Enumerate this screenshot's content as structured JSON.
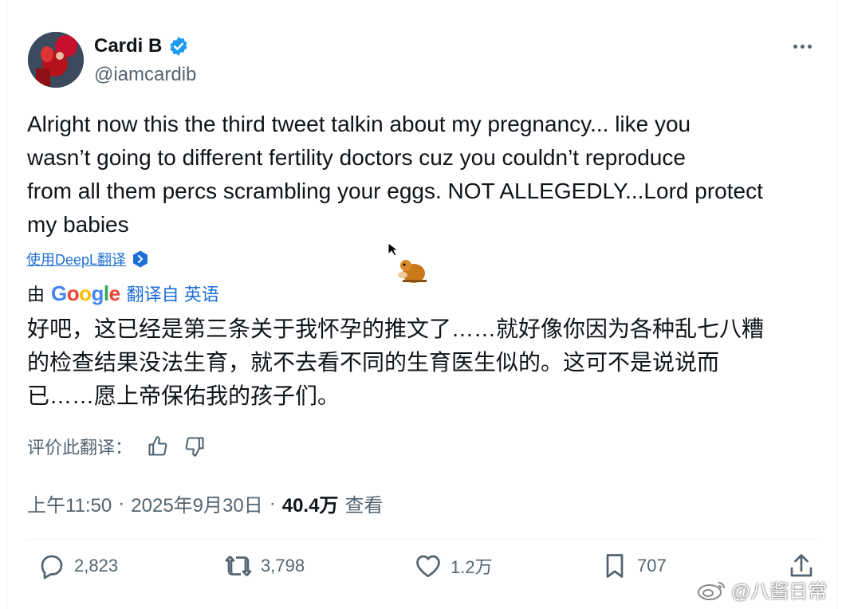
{
  "author": {
    "name": "Cardi B",
    "handle": "@iamcardib",
    "verified_color": "#1d9bf0"
  },
  "tweet": {
    "text": "Alright now this the third tweet talkin about my pregnancy... like you\nwasn’t going to different fertility doctors cuz you couldn’t reproduce\nfrom all them percs scrambling your eggs. NOT ALLEGEDLY...Lord protect\nmy babies"
  },
  "translation": {
    "deepl_link": "使用DeepL翻译",
    "by_label": "由",
    "google_letters": [
      "G",
      "o",
      "o",
      "g",
      "l",
      "e"
    ],
    "translate_from": "翻译自 英语",
    "text": "好吧，这已经是第三条关于我怀孕的推文了……就好像你因为各种乱七八糟\n的检查结果没法生育，就不去看不同的生育医生似的。这可不是说说而\n已……愿上帝保佑我的孩子们。",
    "rate_label": "评价此翻译："
  },
  "meta": {
    "time": "上午11:50",
    "sep1": "·",
    "date": "2025年9月30日",
    "sep2": "·",
    "views": "40.4万",
    "views_label": "查看"
  },
  "actions": {
    "replies": "2,823",
    "reposts": "3,798",
    "likes": "1.2万",
    "bookmarks": "707"
  },
  "watermark": {
    "text": "@八酱日常"
  },
  "icons": {
    "more": "more-icon",
    "reply": "reply-icon",
    "repost": "repost-icon",
    "like": "like-icon",
    "bookmark": "bookmark-icon",
    "share": "share-icon",
    "thumbs_up": "thumbs-up-icon",
    "thumbs_down": "thumbs-down-icon",
    "deepl": "deepl-icon"
  }
}
